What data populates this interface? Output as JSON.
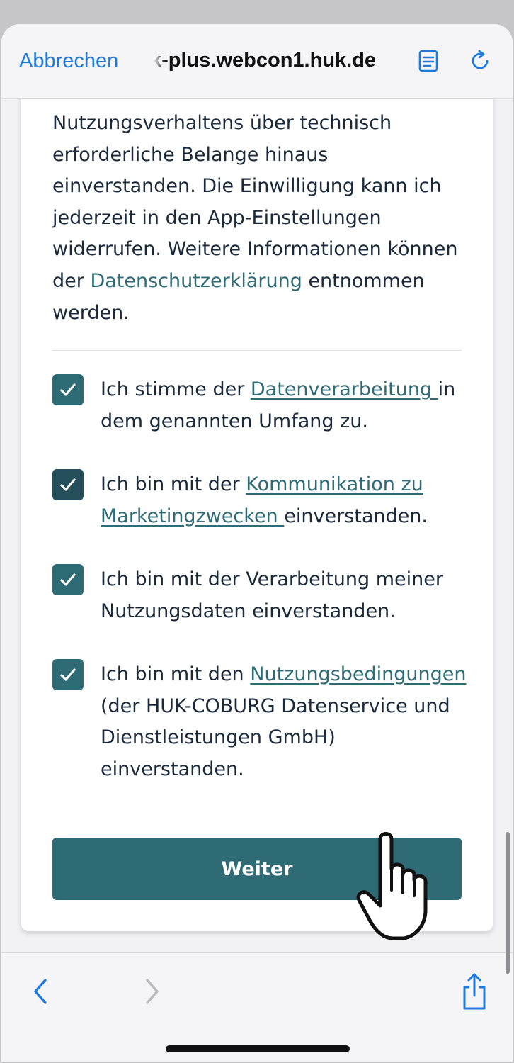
{
  "nav": {
    "cancel_label": "Abbrechen",
    "url": "k-plus.webcon1.huk.de",
    "reader_icon": "reader-view-icon",
    "reload_icon": "reload-icon"
  },
  "intro": {
    "line_cut": "…",
    "text_before_link": "Nutzungsverhaltens über technisch erforderliche Belange hinaus einverstanden. Die Einwilligung kann ich jederzeit in den App-Einstellungen widerrufen. Weitere Informationen können der ",
    "link": "Datenschutzerklärung",
    "text_after_link": " entnommen werden."
  },
  "consents": [
    {
      "checked": true,
      "pre": "Ich stimme der ",
      "link": "Datenverarbeitung ",
      "post": "in dem genannten Umfang zu."
    },
    {
      "checked": true,
      "pre": "Ich bin mit der ",
      "link": "Kommunikation zu Marketingzwecken ",
      "post": "einverstanden."
    },
    {
      "checked": true,
      "pre": "Ich bin mit der Verarbeitung meiner Nutzungsdaten einverstanden.",
      "link": "",
      "post": ""
    },
    {
      "checked": true,
      "pre": "Ich bin mit den ",
      "link": "Nutzungsbedingungen",
      "post": " (der HUK-COBURG Datenservice und Dienstleistungen GmbH) einverstanden."
    }
  ],
  "button": {
    "label": "Weiter"
  },
  "toolbar": {
    "back_icon": "back-chevron-icon",
    "forward_icon": "forward-chevron-icon",
    "share_icon": "share-icon"
  },
  "colors": {
    "accent": "#2f6b75",
    "link_blue": "#1f7ae0",
    "text": "#1b2a3a"
  }
}
